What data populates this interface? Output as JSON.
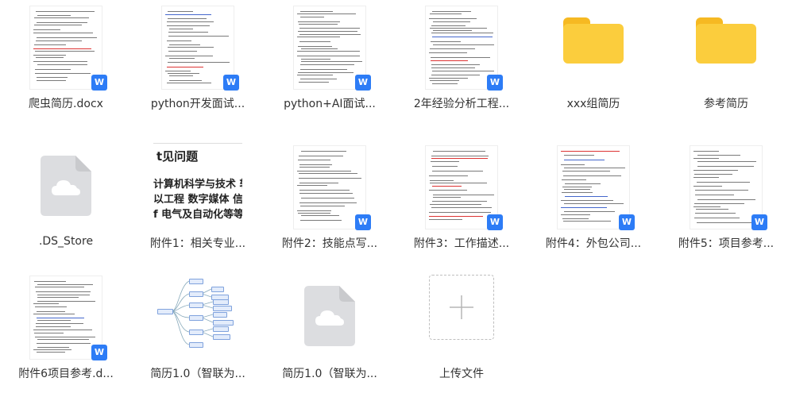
{
  "files": [
    {
      "name": "爬虫简历.docx",
      "kind": "doc",
      "badge": "W"
    },
    {
      "name": "python开发面试...",
      "kind": "doc",
      "badge": "W"
    },
    {
      "name": "python+AI面试...",
      "kind": "doc",
      "badge": "W"
    },
    {
      "name": "2年经验分析工程...",
      "kind": "doc",
      "badge": "W"
    },
    {
      "name": "xxx组简历",
      "kind": "folder"
    },
    {
      "name": "参考简历",
      "kind": "folder"
    },
    {
      "name": ".DS_Store",
      "kind": "cloud"
    },
    {
      "name": "附件1：相关专业...",
      "kind": "text-preview"
    },
    {
      "name": "附件2：技能点写...",
      "kind": "doc",
      "badge": "W"
    },
    {
      "name": "附件3：工作描述...",
      "kind": "doc",
      "badge": "W"
    },
    {
      "name": "附件4：外包公司...",
      "kind": "doc",
      "badge": "W"
    },
    {
      "name": "附件5：项目参考...",
      "kind": "doc",
      "badge": "W"
    },
    {
      "name": "附件6项目参考.d...",
      "kind": "doc",
      "badge": "W"
    },
    {
      "name": "简历1.0（智联为...",
      "kind": "mindmap"
    },
    {
      "name": "简历1.0（智联为...",
      "kind": "cloud"
    },
    {
      "name": "上传文件",
      "kind": "upload"
    }
  ],
  "text_preview": {
    "line1": "t见问题",
    "line2": "计算机科学与技术 软作",
    "line3": "以工程 数字媒体 信息管",
    "line4": "f 电气及自动化等等"
  },
  "colors": {
    "folder": "#fbcd3d",
    "word_badge": "#2d7cf6",
    "label_text": "#333333"
  }
}
